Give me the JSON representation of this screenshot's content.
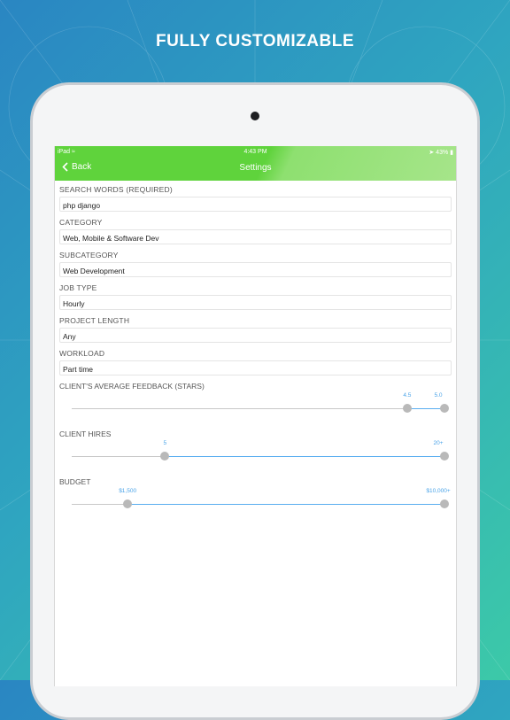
{
  "promo": {
    "headline": "FULLY CUSTOMIZABLE"
  },
  "status_bar": {
    "device": "iPad",
    "time": "4:43 PM",
    "battery": "43%"
  },
  "nav": {
    "back_label": "Back",
    "title": "Settings"
  },
  "fields": [
    {
      "label": "SEARCH WORDS (REQUIRED)",
      "value": "php django"
    },
    {
      "label": "CATEGORY",
      "value": "Web, Mobile & Software Dev"
    },
    {
      "label": "SUBCATEGORY",
      "value": "Web Development"
    },
    {
      "label": "JOB TYPE",
      "value": "Hourly"
    },
    {
      "label": "PROJECT LENGTH",
      "value": "Any"
    },
    {
      "label": "WORKLOAD",
      "value": "Part time"
    }
  ],
  "sliders": [
    {
      "label": "CLIENT'S AVERAGE FEEDBACK (STARS)",
      "low_label": "4.5",
      "high_label": "5.0",
      "low_fraction": 0.9,
      "high_fraction": 1.0
    },
    {
      "label": "CLIENT HIRES",
      "low_label": "5",
      "high_label": "20+",
      "low_fraction": 0.25,
      "high_fraction": 1.0
    },
    {
      "label": "BUDGET",
      "low_label": "$1,500",
      "high_label": "$10,000+",
      "low_fraction": 0.15,
      "high_fraction": 1.0
    }
  ],
  "colors": {
    "nav_green": "#5fd33c",
    "accent_blue": "#4aa3e8"
  }
}
